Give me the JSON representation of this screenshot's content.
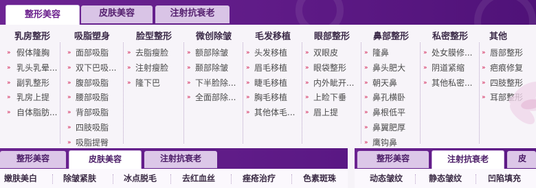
{
  "top_tabs": [
    {
      "label": "整形美容",
      "active": true
    },
    {
      "label": "皮肤美容",
      "active": false
    },
    {
      "label": "注射抗衰老",
      "active": false
    }
  ],
  "columns": [
    {
      "title": "乳房整形",
      "items": [
        "假体隆胸",
        "乳头乳晕...",
        "副乳整形",
        "乳房上提",
        "自体脂肪..."
      ]
    },
    {
      "title": "吸脂塑身",
      "items": [
        "面部吸脂",
        "双下巴吸...",
        "腹部吸脂",
        "腰部吸脂",
        "背部吸脂",
        "四肢吸脂",
        "吸脂提臀"
      ]
    },
    {
      "title": "脸型整形",
      "items": [
        "去脂瘦脸",
        "注射瘦脸",
        "隆下巴"
      ]
    },
    {
      "title": "微创除皱",
      "items": [
        "额部除皱",
        "颞部除皱",
        "下半脸除...",
        "全面部除..."
      ]
    },
    {
      "title": "毛发移植",
      "items": [
        "头发移植",
        "眉毛移植",
        "睫毛移植",
        "胸毛移植",
        "其他体毛..."
      ]
    },
    {
      "title": "眼部整形",
      "items": [
        "双眼皮",
        "眼袋整形",
        "内外眦开...",
        "上睑下垂",
        "眉上提"
      ]
    },
    {
      "title": "鼻部整形",
      "items": [
        "隆鼻",
        "鼻头肥大",
        "朝天鼻",
        "鼻孔横卧",
        "鼻根低平",
        "鼻翼肥厚",
        "鹰钩鼻"
      ]
    },
    {
      "title": "私密整形",
      "items": [
        "处女膜修...",
        "阴道紧缩",
        "其他私密..."
      ]
    },
    {
      "title": "其他",
      "items": [
        "唇部整形",
        "疤痕修复",
        "四肢整形",
        "耳部整形"
      ]
    }
  ],
  "bottom_left": {
    "tabs": [
      {
        "label": "整形美容",
        "active": false
      },
      {
        "label": "皮肤美容",
        "active": true
      },
      {
        "label": "注射抗衰老",
        "active": false
      }
    ],
    "items": [
      "嫩肤美白",
      "除皱紧肤",
      "冰点脱毛",
      "去红血丝",
      "痤疮治疗",
      "色素斑珠"
    ]
  },
  "bottom_right": {
    "tabs": [
      {
        "label": "整形美容",
        "active": false
      },
      {
        "label": "注射抗衰老",
        "active": true
      },
      {
        "label": "皮",
        "active": false
      }
    ],
    "items": [
      "动态皱纹",
      "静态皱纹",
      "凹陷填充"
    ]
  },
  "colors": {
    "purple": "#5e1a86",
    "bullet": "#d0144a",
    "tab_inactive": "#d9c4e6"
  },
  "icons": {
    "bullet": "double-chevron-icon"
  }
}
